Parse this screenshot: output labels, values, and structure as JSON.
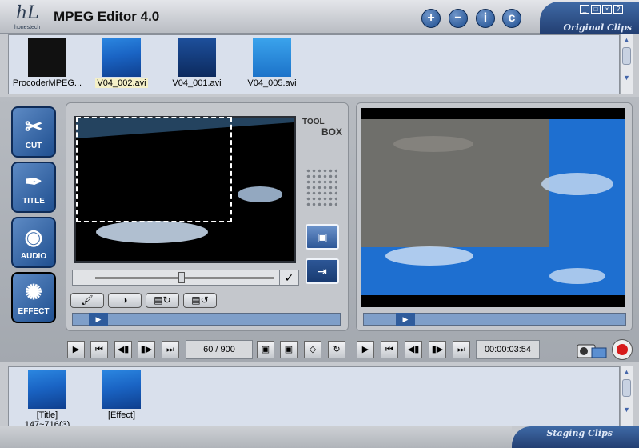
{
  "app": {
    "title": "MPEG Editor 4.0",
    "brand": "honestech",
    "logo_letters": "hL"
  },
  "header_buttons": [
    {
      "name": "add-icon",
      "glyph": "+"
    },
    {
      "name": "remove-icon",
      "glyph": "−"
    },
    {
      "name": "info-icon",
      "glyph": "i"
    },
    {
      "name": "copyright-icon",
      "glyph": "c"
    }
  ],
  "window_controls": {
    "minimize": "_",
    "restore": "□",
    "close": "×",
    "help": "?"
  },
  "original_clips": {
    "label": "Original Clips",
    "items": [
      {
        "label": "ProcoderMPEG...",
        "color": "#111",
        "selected": false
      },
      {
        "label": "V04_002.avi",
        "color": "#2e8ae0",
        "selected": true
      },
      {
        "label": "V04_001.avi",
        "color": "#1d4f9b",
        "selected": false
      },
      {
        "label": "V04_005.avi",
        "color": "#2590dd",
        "selected": false
      }
    ]
  },
  "tools": [
    {
      "label": "CUT",
      "icon": "scissors-icon",
      "glyph": "✂"
    },
    {
      "label": "TITLE",
      "icon": "pen-nib-icon",
      "glyph": "✒"
    },
    {
      "label": "AUDIO",
      "icon": "audio-waves-icon",
      "glyph": "◉"
    },
    {
      "label": "EFFECT",
      "icon": "swirl-icon",
      "glyph": "✺"
    }
  ],
  "toolbox": {
    "line1": "TOOL",
    "line2": "BOX"
  },
  "edit_controls": {
    "confirm": "✓"
  },
  "frame_counter": "60 / 900",
  "time_counter": "00:00:03:54",
  "staging_clips": {
    "label": "Staging Clips",
    "items": [
      {
        "label": "[Title]",
        "sublabel": "147~716(3)"
      },
      {
        "label": "[Effect]",
        "sublabel": ""
      }
    ]
  },
  "colors": {
    "accent": "#1f4f90",
    "record": "#d71a1a"
  }
}
